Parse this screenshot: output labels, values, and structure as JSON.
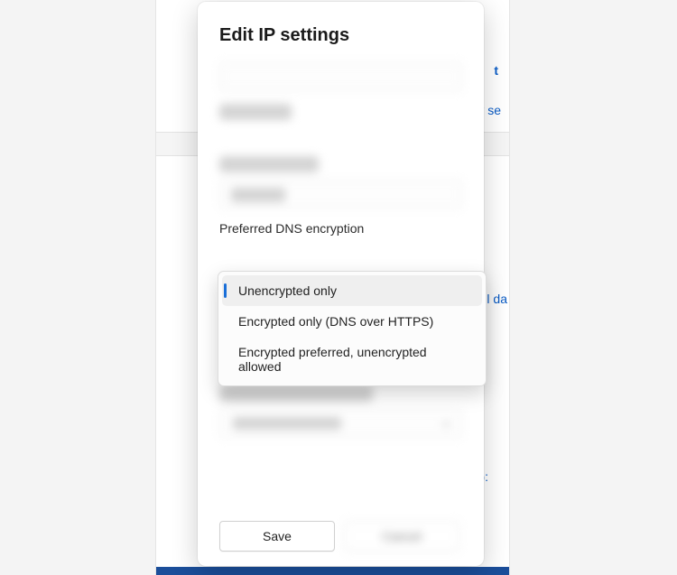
{
  "background": {
    "title_fragment": "t",
    "link1_fragment": "ty se",
    "link2_fragment": "ol da",
    "text3_fragment": "):",
    "text4_fragment": ""
  },
  "modal": {
    "title": "Edit IP settings",
    "section_label": "Preferred DNS encryption",
    "options": [
      "Unencrypted only",
      "Encrypted only (DNS over HTTPS)",
      "Encrypted preferred, unencrypted allowed"
    ],
    "selected_index": 0,
    "save_label": "Save",
    "cancel_label": "Cancel"
  }
}
